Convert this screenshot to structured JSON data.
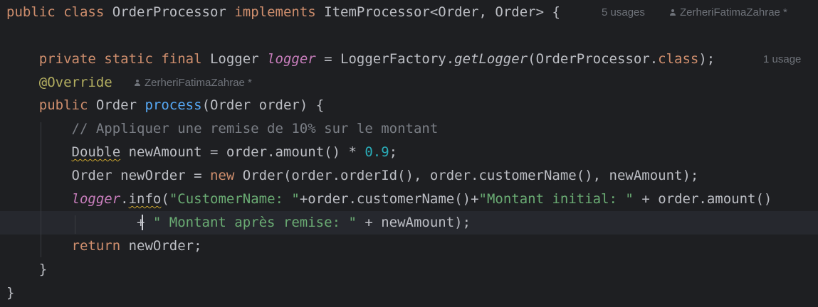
{
  "editor": {
    "lines": [
      {
        "tokens": [
          {
            "t": "public class ",
            "c": "kw"
          },
          {
            "t": "OrderProcessor "
          },
          {
            "t": "implements ",
            "c": "kw"
          },
          {
            "t": "ItemProcessor<Order, Order> {"
          }
        ],
        "hints": [
          {
            "text": "5 usages"
          },
          {
            "text": "ZerheriFatimaZahrae *",
            "icon": "author-icon"
          }
        ]
      },
      {
        "tokens": []
      },
      {
        "tokens": [
          {
            "t": "    "
          },
          {
            "t": "private static final ",
            "c": "kw"
          },
          {
            "t": "Logger "
          },
          {
            "t": "logger",
            "c": "fld"
          },
          {
            "t": " = LoggerFactory."
          },
          {
            "t": "getLogger",
            "c": "it"
          },
          {
            "t": "(OrderProcessor."
          },
          {
            "t": "class",
            "c": "kw"
          },
          {
            "t": ");"
          }
        ],
        "hints": [
          {
            "text": "1 usage"
          }
        ]
      },
      {
        "tokens": [
          {
            "t": "    "
          },
          {
            "t": "@Override",
            "c": "ann"
          }
        ],
        "hints": [
          {
            "text": "ZerheriFatimaZahrae *",
            "icon": "author-icon"
          }
        ]
      },
      {
        "tokens": [
          {
            "t": "    "
          },
          {
            "t": "public ",
            "c": "kw"
          },
          {
            "t": "Order "
          },
          {
            "t": "process",
            "c": "fn"
          },
          {
            "t": "(Order order) {"
          }
        ]
      },
      {
        "tokens": [
          {
            "t": "        "
          },
          {
            "t": "// Appliquer une remise de 10% sur le montant",
            "c": "cmt"
          }
        ]
      },
      {
        "tokens": [
          {
            "t": "        "
          },
          {
            "t": "Double",
            "c": "squig"
          },
          {
            "t": " newAmount = order.amount() * "
          },
          {
            "t": "0.9",
            "c": "num"
          },
          {
            "t": ";"
          }
        ]
      },
      {
        "tokens": [
          {
            "t": "        Order newOrder = "
          },
          {
            "t": "new ",
            "c": "kw"
          },
          {
            "t": "Order(order.orderId(), order.customerName(), newAmount);"
          }
        ]
      },
      {
        "tokens": [
          {
            "t": "        "
          },
          {
            "t": "logger",
            "c": "fld"
          },
          {
            "t": "."
          },
          {
            "t": "info",
            "c": "squig"
          },
          {
            "t": "("
          },
          {
            "t": "\"CustomerName: \"",
            "c": "str"
          },
          {
            "t": "+order.customerName()+"
          },
          {
            "t": "\"Montant initial: \"",
            "c": "str"
          },
          {
            "t": " + order.amount()"
          }
        ]
      },
      {
        "tokens": [
          {
            "t": "                + "
          },
          {
            "t": "\" Montant après remise: \"",
            "c": "str"
          },
          {
            "t": " + newAmount);"
          }
        ]
      },
      {
        "tokens": [
          {
            "t": "        "
          },
          {
            "t": "return ",
            "c": "kw"
          },
          {
            "t": "newOrder;"
          }
        ]
      },
      {
        "tokens": [
          {
            "t": "    }"
          }
        ]
      },
      {
        "tokens": [
          {
            "t": "}"
          }
        ]
      }
    ]
  }
}
